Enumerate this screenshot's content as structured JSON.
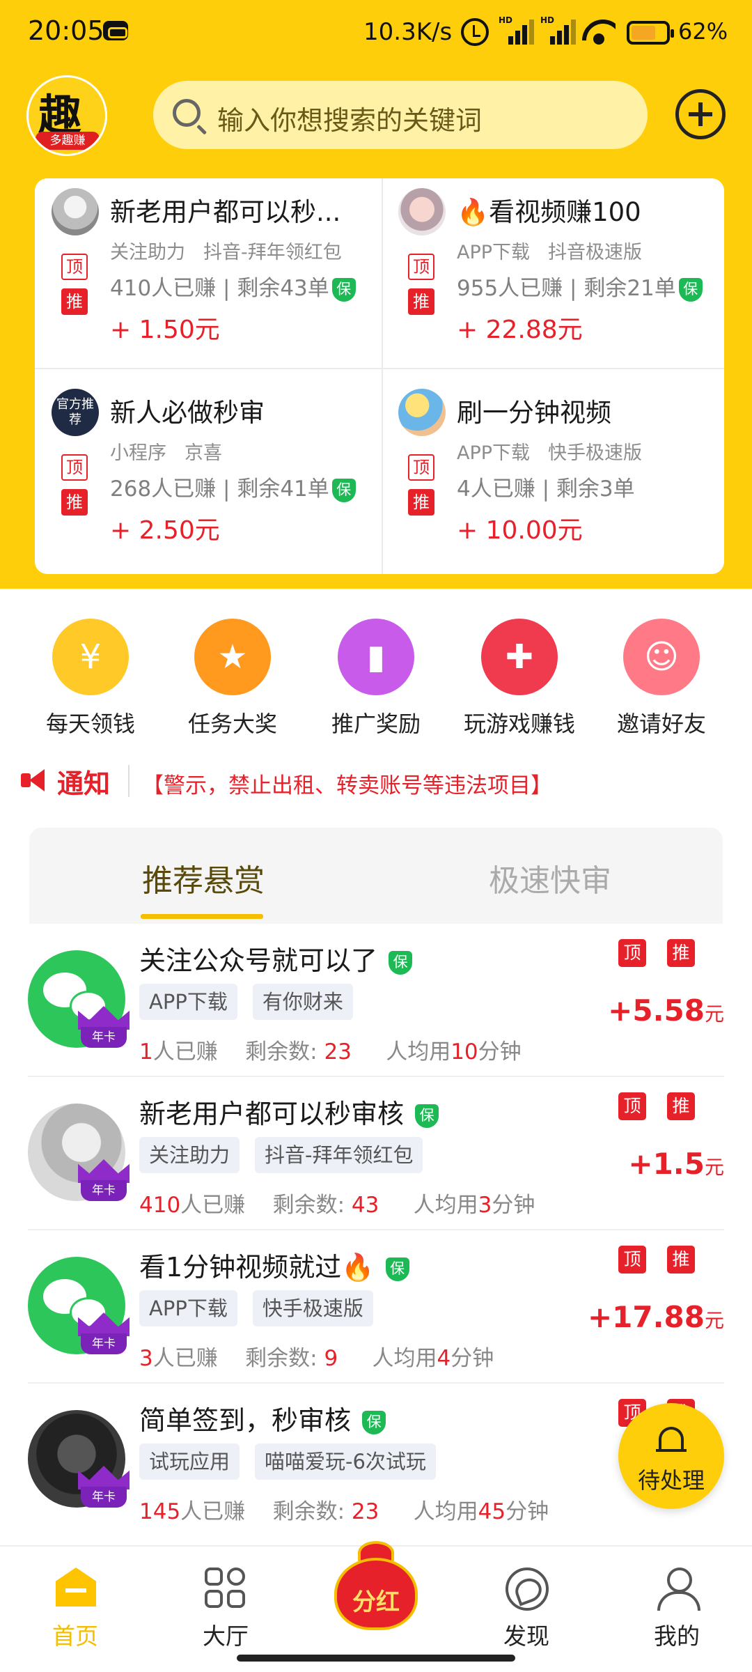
{
  "status_bar": {
    "time": "20:05",
    "speed": "10.3K/s",
    "battery": "62%",
    "signal1": "HD",
    "signal2": "HD"
  },
  "header": {
    "logo_char": "趣",
    "logo_sub": "多趣赚",
    "search_placeholder": "输入你想搜索的关键词"
  },
  "featured": [
    {
      "title": "新老用户都可以秒...",
      "tags": [
        "关注助力",
        "抖音-拜年领红包"
      ],
      "earned": "410人已赚",
      "remaining": "剩余43单",
      "price": "+ 1.50元",
      "avatar": "user-photo"
    },
    {
      "title": "🔥看视频赚100",
      "tags": [
        "APP下载",
        "抖音极速版"
      ],
      "earned": "955人已赚",
      "remaining": "剩余21单",
      "price": "+ 22.88元",
      "avatar": "girl-photo"
    },
    {
      "title": "新人必做秒审",
      "tags": [
        "小程序",
        "京喜"
      ],
      "earned": "268人已赚",
      "remaining": "剩余41单",
      "price": "+ 2.50元",
      "avatar": "official",
      "avatar_text": "官方推荐"
    },
    {
      "title": "刷一分钟视频",
      "tags": [
        "APP下载",
        "快手极速版"
      ],
      "earned": "4人已赚",
      "remaining": "剩余3单",
      "price": "+ 10.00元",
      "avatar": "anime"
    }
  ],
  "badges": {
    "ding": "顶",
    "tui": "推",
    "bao": "保"
  },
  "categories": [
    {
      "label": "每天领钱",
      "color": "#FFC928",
      "icon": "money-bag-icon",
      "glyph": "¥"
    },
    {
      "label": "任务大奖",
      "color": "#FF9A1F",
      "icon": "user-reward-icon",
      "glyph": "★"
    },
    {
      "label": "推广奖励",
      "color": "#C85BEA",
      "icon": "bar-chart-icon",
      "glyph": "▮"
    },
    {
      "label": "玩游戏赚钱",
      "color": "#F03A4E",
      "icon": "gamepad-icon",
      "glyph": "✚"
    },
    {
      "label": "邀请好友",
      "color": "#FF7A86",
      "icon": "invite-friends-icon",
      "glyph": "☺"
    }
  ],
  "notice": {
    "tag": "通知",
    "text": "【警示，禁止出租、转卖账号等违法项目】"
  },
  "tabs": {
    "active": "推荐悬赏",
    "inactive": "极速快审"
  },
  "tasks": [
    {
      "title": "关注公众号就可以了",
      "tags": [
        "APP下载",
        "有你财来"
      ],
      "earned_num": "1",
      "earned_suffix": "人已赚",
      "remaining_label": "剩余数: ",
      "remaining_num": "23",
      "avg_prefix": "人均用",
      "avg_num": "10",
      "avg_suffix": "分钟",
      "reward": "+5.58",
      "unit": "元",
      "crown": "年卡",
      "avatar": "wechat"
    },
    {
      "title": "新老用户都可以秒审核",
      "tags": [
        "关注助力",
        "抖音-拜年领红包"
      ],
      "earned_num": "410",
      "earned_suffix": "人已赚",
      "remaining_label": "剩余数: ",
      "remaining_num": "43",
      "avg_prefix": "人均用",
      "avg_num": "3",
      "avg_suffix": "分钟",
      "reward": "+1.5",
      "unit": "元",
      "crown": "年卡",
      "avatar": "person"
    },
    {
      "title": "看1分钟视频就过🔥",
      "tags": [
        "APP下载",
        "快手极速版"
      ],
      "earned_num": "3",
      "earned_suffix": "人已赚",
      "remaining_label": "剩余数: ",
      "remaining_num": "9",
      "avg_prefix": "人均用",
      "avg_num": "4",
      "avg_suffix": "分钟",
      "reward": "+17.88",
      "unit": "元",
      "crown": "年卡",
      "avatar": "wechat"
    },
    {
      "title": "简单签到，秒审核",
      "tags": [
        "试玩应用",
        "喵喵爱玩-6次试玩"
      ],
      "earned_num": "145",
      "earned_suffix": "人已赚",
      "remaining_label": "剩余数: ",
      "remaining_num": "23",
      "avg_prefix": "人均用",
      "avg_num": "45",
      "avg_suffix": "分钟",
      "reward": "+",
      "unit": "",
      "crown": "年卡",
      "avatar": "dark"
    }
  ],
  "pending": {
    "label": "待处理"
  },
  "bottom_nav": {
    "home": "首页",
    "hall": "大厅",
    "dividend": "分红",
    "discover": "发现",
    "me": "我的"
  },
  "colors": {
    "brand_yellow": "#FFCE0A",
    "accent_red": "#E6212A",
    "shield_green": "#1DB954"
  }
}
